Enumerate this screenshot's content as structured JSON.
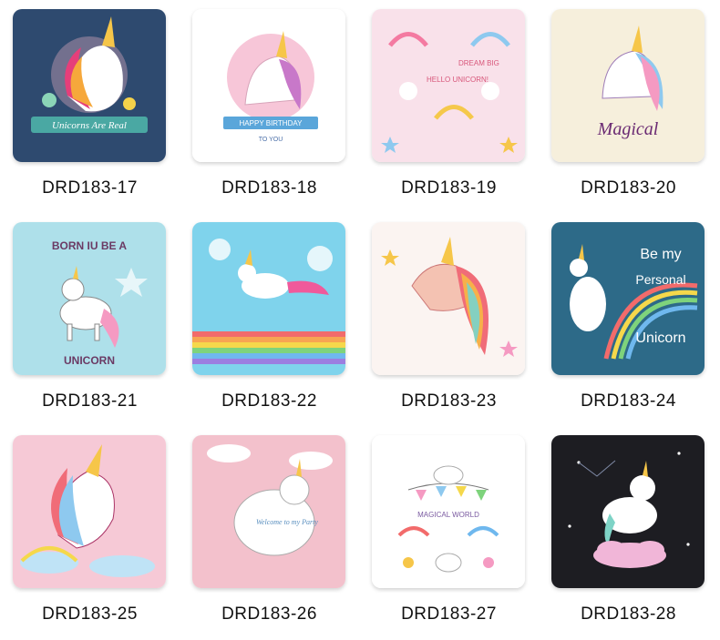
{
  "products": [
    {
      "code": "DRD183-17",
      "caption": "Unicorns Are Real",
      "bg": "#2e4a6f"
    },
    {
      "code": "DRD183-18",
      "caption": "HAPPY BIRTHDAY",
      "caption2": "TO YOU",
      "bg": "#ffffff"
    },
    {
      "code": "DRD183-19",
      "caption": "HELLO UNICORN!",
      "caption2": "DREAM BIG",
      "bg": "#f9e1ea"
    },
    {
      "code": "DRD183-20",
      "caption": "Magical",
      "bg": "#f6efdc"
    },
    {
      "code": "DRD183-21",
      "caption": "BORN IU BE A",
      "caption2": "UNICORN",
      "bg": "#aee0ea"
    },
    {
      "code": "DRD183-22",
      "caption": "",
      "bg": "#7fd3ec"
    },
    {
      "code": "DRD183-23",
      "caption": "",
      "bg": "#fbf4f1"
    },
    {
      "code": "DRD183-24",
      "caption": "Be my",
      "caption2": "Personal",
      "caption3": "Unicorn",
      "bg": "#2d6a88"
    },
    {
      "code": "DRD183-25",
      "caption": "",
      "bg": "#f6c9d6"
    },
    {
      "code": "DRD183-26",
      "caption": "Welcome to my Party",
      "bg": "#f3c1cc"
    },
    {
      "code": "DRD183-27",
      "caption": "MAGICAL WORLD",
      "bg": "#ffffff"
    },
    {
      "code": "DRD183-28",
      "caption": "",
      "bg": "#1d1d22"
    }
  ]
}
